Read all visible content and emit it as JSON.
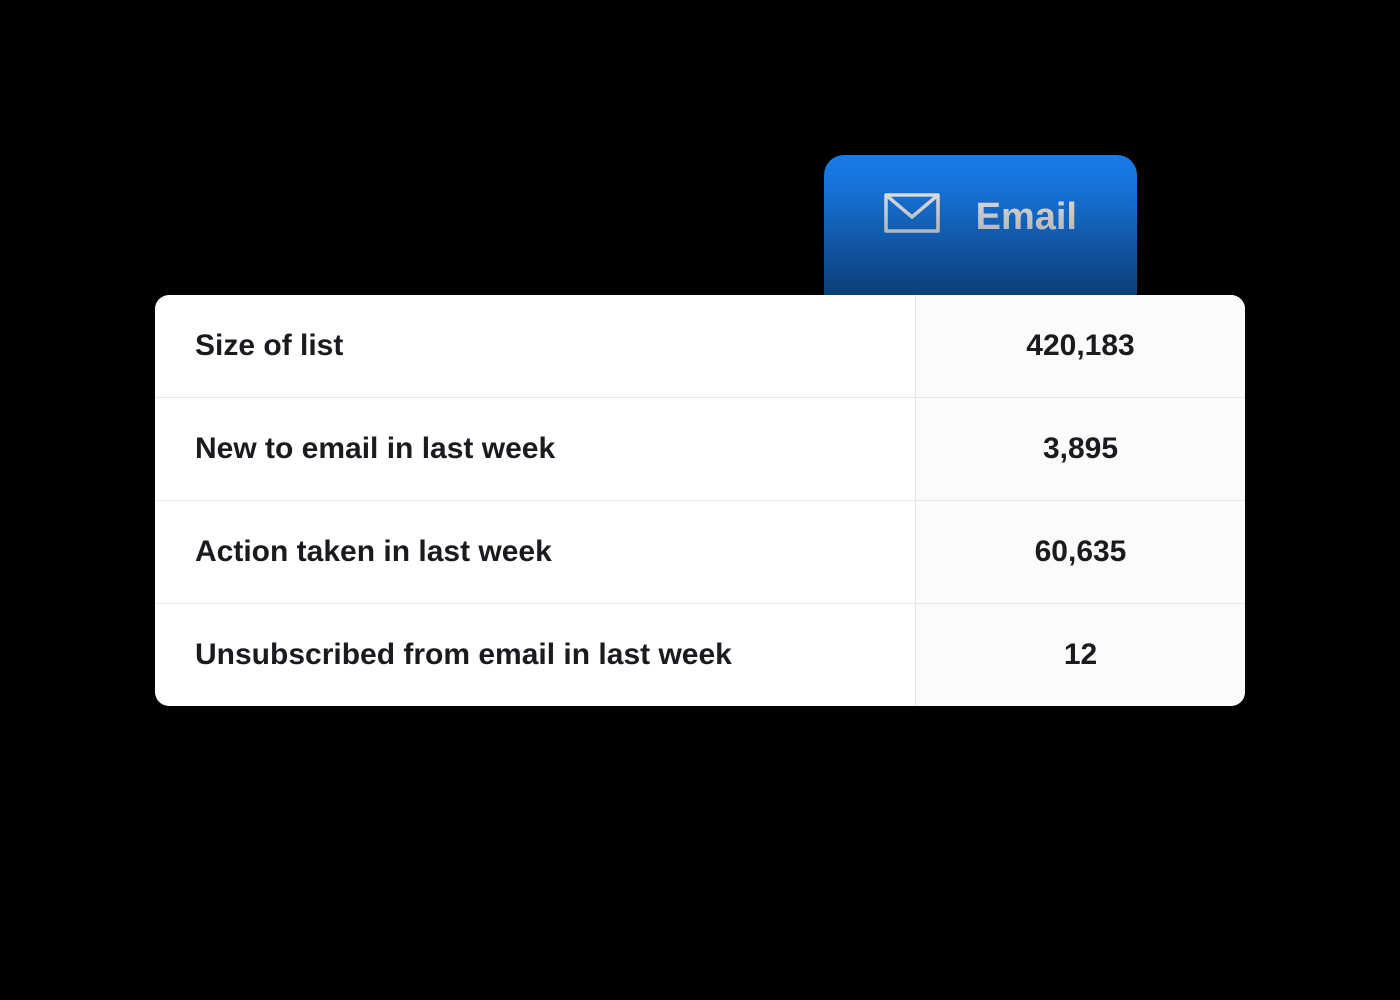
{
  "tab": {
    "label": "Email"
  },
  "metrics": [
    {
      "label": "Size of list",
      "value": "420,183"
    },
    {
      "label": "New to email in last week",
      "value": "3,895"
    },
    {
      "label": "Action taken in last week",
      "value": "60,635"
    },
    {
      "label": "Unsubscribed from email in last week",
      "value": "12"
    }
  ]
}
